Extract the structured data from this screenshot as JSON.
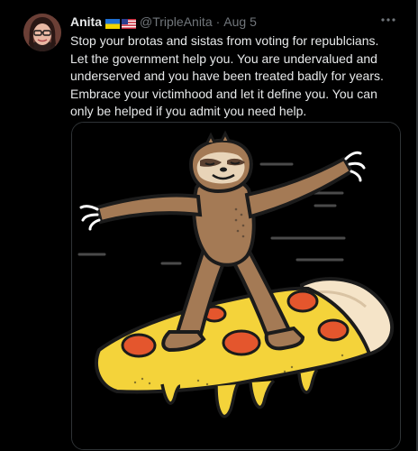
{
  "tweet": {
    "display_name": "Anita",
    "flags": [
      "ukraine-flag",
      "usa-flag"
    ],
    "handle": "@TripleAnita",
    "separator": "·",
    "date": "Aug 5",
    "text": "Stop your brotas and sistas from voting for republcians. Let the government help you. You are undervalued and underserved and you have been treated badly for years. Embrace your victimhood and let it define you. You can only be helped if you admit you need help."
  },
  "icons": {
    "more": "more-horizontal-icon",
    "avatar": "profile-photo"
  },
  "media": {
    "description_icon": "sloth-surfing-pizza-illustration"
  },
  "colors": {
    "background": "#000000",
    "text_primary": "#e7e9ea",
    "text_secondary": "#71767b",
    "border": "#2f3336",
    "sloth": "#a47a55",
    "cheese": "#f4d33a",
    "crust": "#f5e4c8",
    "pepperoni": "#e4562d"
  }
}
